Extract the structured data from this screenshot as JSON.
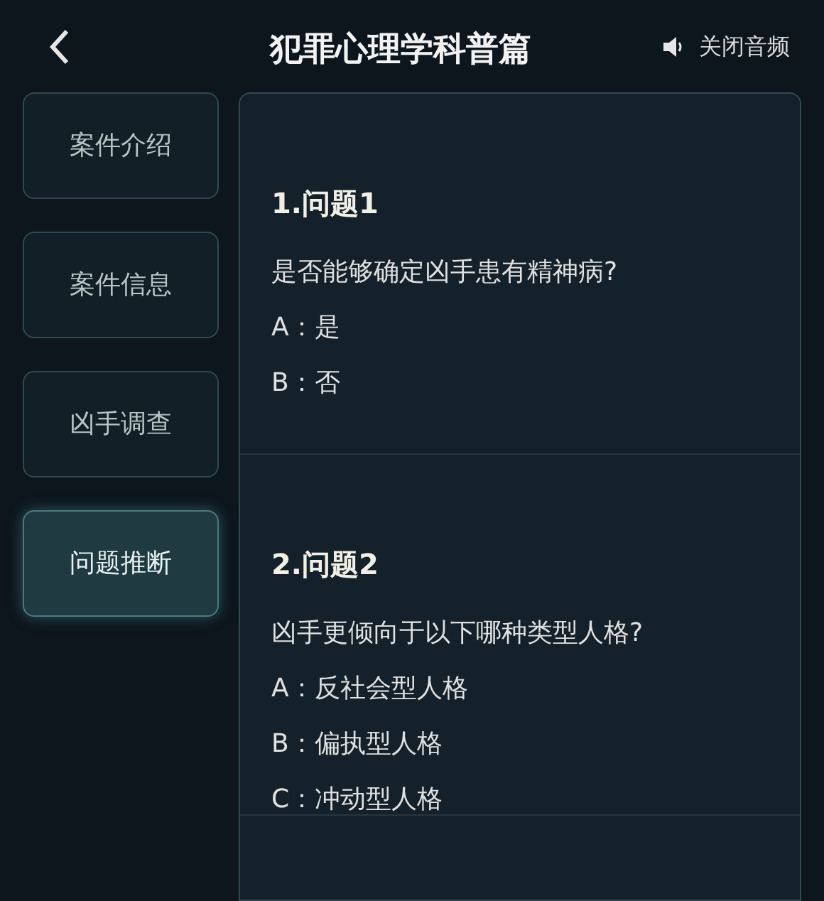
{
  "header": {
    "title": "犯罪心理学科普篇",
    "audio_button": "关闭音频"
  },
  "sidebar": {
    "items": [
      {
        "label": "案件介绍",
        "selected": false
      },
      {
        "label": "案件信息",
        "selected": false
      },
      {
        "label": "凶手调查",
        "selected": false
      },
      {
        "label": "问题推断",
        "selected": true
      }
    ]
  },
  "questions": [
    {
      "heading": "1.问题1",
      "text": "是否能够确定凶手患有精神病?",
      "options": [
        "A：是",
        "B：否"
      ]
    },
    {
      "heading": "2.问题2",
      "text": "凶手更倾向于以下哪种类型人格?",
      "options": [
        "A：反社会型人格",
        "B：偏执型人格",
        "C：冲动型人格"
      ]
    }
  ]
}
